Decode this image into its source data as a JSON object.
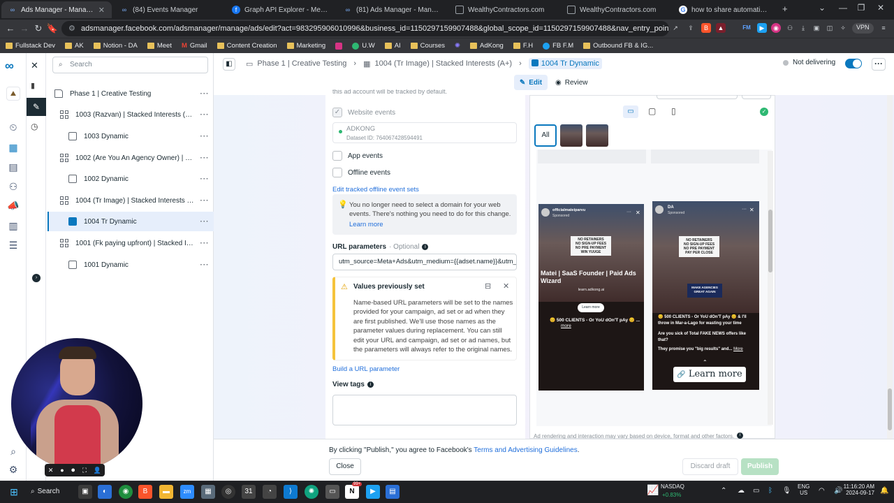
{
  "browser": {
    "tabs": [
      {
        "title": "Ads Manager - Manage ads - A",
        "active": true,
        "icon": "meta-icon"
      },
      {
        "title": "(84) Events Manager",
        "icon": "meta-icon"
      },
      {
        "title": "Graph API Explorer - Meta for Deve",
        "icon": "facebook-icon"
      },
      {
        "title": "(81) Ads Manager - Manage ads - C",
        "icon": "meta-icon"
      },
      {
        "title": "WealthyContractors.com",
        "icon": "page-icon"
      },
      {
        "title": "WealthyContractors.com",
        "icon": "page-icon"
      },
      {
        "title": "how to share automations as a link",
        "icon": "google-icon"
      }
    ],
    "new_tab": "+",
    "url": "adsmanager.facebook.com/adsmanager/manage/ads/edit?act=983295906010996&business_id=1150297159907488&global_scope_id=1150297159907488&nav_entry_point=am_local_scope_selector&c...",
    "vpn": "VPN",
    "bookmarks": [
      "Fullstack Dev",
      "AK",
      "Notion - DA",
      "Meet",
      "Gmail",
      "Content Creation",
      "Marketing",
      "U.W",
      "AI",
      "Courses",
      "AdKong",
      "F.H",
      "FB F.M",
      "Outbound FB & IG..."
    ]
  },
  "sidepanel": {
    "search_placeholder": "Search",
    "tree": [
      {
        "label": "Phase 1 | Creative Testing",
        "type": "campaign",
        "level": 0
      },
      {
        "label": "1003 (Razvan) | Stacked Interests (A+)",
        "type": "adset",
        "level": 1
      },
      {
        "label": "1003 Dynamic",
        "type": "ad",
        "level": 2
      },
      {
        "label": "1002 (Are You An Agency Owner) | Sta...",
        "type": "adset",
        "level": 1
      },
      {
        "label": "1002 Dynamic",
        "type": "ad",
        "level": 2
      },
      {
        "label": "1004 (Tr Image) | Stacked Interests (A+)",
        "type": "adset",
        "level": 1
      },
      {
        "label": "1004 Tr Dynamic",
        "type": "ad",
        "level": 2,
        "selected": true
      },
      {
        "label": "1001 (Fk paying upfront) | Stacked Inte...",
        "type": "adset",
        "level": 1
      },
      {
        "label": "1001 Dynamic",
        "type": "ad",
        "level": 2
      }
    ]
  },
  "header": {
    "breadcrumbs": [
      "Phase 1 | Creative Testing",
      "1004 (Tr Image) | Stacked Interests (A+)",
      "1004 Tr Dynamic"
    ],
    "edit_label": "Edit",
    "review_label": "Review",
    "status": "Not delivering"
  },
  "form": {
    "top_cut_text": "this ad account will be tracked by default.",
    "website_events": "Website events",
    "dataset_name": "ADKONG",
    "dataset_id": "Dataset ID: 764067428594491",
    "app_events": "App events",
    "offline_events": "Offline events",
    "edit_offline_link": "Edit tracked offline event sets",
    "domain_notice": "You no longer need to select a domain for your web events. There's nothing you need to do for this change.",
    "learn_more": "Learn more",
    "url_params_label": "URL parameters",
    "url_params_optional": "· Optional",
    "url_params_value": "utm_source=Meta+Ads&utm_medium={{adset.name}}&utm_",
    "warning_title": "Values previously set",
    "warning_body": "Name-based URL parameters will be set to the names provided for your campaign, ad set or ad when they are first published. We'll use those names as the parameter values during replacement. You can still edit your URL and campaign, ad set or ad names, but the parameters will always refer to the original names.",
    "build_param_link": "Build a URL parameter",
    "view_tags_label": "View tags"
  },
  "preview": {
    "all_label": "All",
    "ad1": {
      "page": "officialmateiparvu",
      "sponsored": "Sponsored",
      "headline": "Matei | SaaS Founder | Paid Ads Wizard",
      "url": "learn.adkong.ai",
      "cta": "Learn more",
      "caption": "😊 500 CLIENTS - Or YoU dOn'T pAy 😊 ...",
      "more": "more",
      "sign_lines": [
        "NO RETAINERS",
        "NO SIGN-UP FEES",
        "NO PRE PAYMENT",
        "WIN YUUGE"
      ]
    },
    "ad2": {
      "page": "DA",
      "sponsored": "Sponsored",
      "caption": "😊 500 CLIENTS - Or YoU dOn'T pAy 😊 & I'll throw in Mar-a-Lago for wasting your time",
      "caption2": "Are you sick of Total FAKE NEWS offers like that?",
      "caption3": "They promise you \"big results\" and...",
      "more": "More",
      "cta": "Learn more",
      "sign_lines": [
        "NO RETAINERS",
        "NO SIGN-UP FEES",
        "NO PRE PAYMENT",
        "PAY PER CLOSE"
      ],
      "sign2": "MAKE AGENCIES GREAT AGAIN"
    },
    "disclaimer": "Ad rendering and interaction may vary based on device, format and other factors."
  },
  "footer": {
    "terms_prefix": "By clicking \"Publish,\" you agree to Facebook's",
    "terms_link": "Terms and Advertising Guidelines",
    "close": "Close",
    "discard": "Discard draft",
    "publish": "Publish"
  },
  "taskbar": {
    "search": "Search",
    "stock_name": "NASDAQ",
    "stock_change": "+0.83%",
    "lang1": "ENG",
    "lang2": "US",
    "time": "11:16:20 AM",
    "date": "2024-09-17",
    "badge": "99+"
  },
  "colors": {
    "accent": "#0a78be",
    "warning": "#f5c33b",
    "link": "#216fdb"
  }
}
